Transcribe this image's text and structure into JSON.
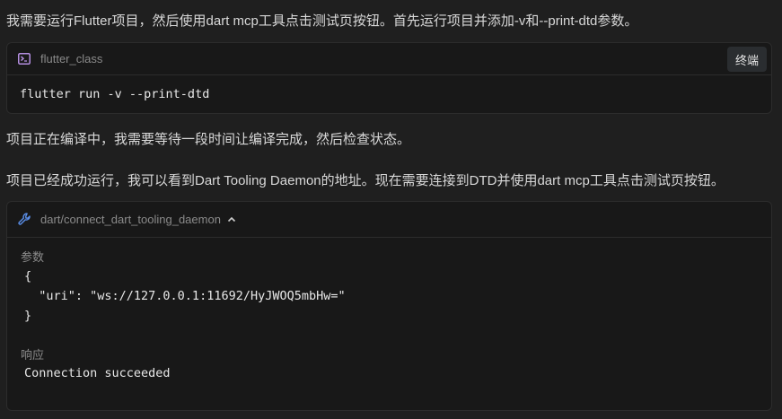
{
  "messages": {
    "intro": "我需要运行Flutter项目，然后使用dart mcp工具点击测试页按钮。首先运行项目并添加-v和--print-dtd参数。",
    "waiting": "项目正在编译中，我需要等待一段时间让编译完成，然后检查状态。",
    "running": "项目已经成功运行，我可以看到Dart Tooling Daemon的地址。现在需要连接到DTD并使用dart mcp工具点击测试页按钮。"
  },
  "command_card": {
    "icon": "terminal-icon",
    "title": "flutter_class",
    "terminate_label": "终端",
    "command": "flutter run -v --print-dtd"
  },
  "tool_card": {
    "icon": "wrench-icon",
    "title": "dart/connect_dart_tooling_daemon",
    "params_label": "参数",
    "params_open": "{",
    "params_line": "  \"uri\": \"ws://127.0.0.1:11692/HyJWOQ5mbHw=\"",
    "params_close": "}",
    "response_label": "响应",
    "response": "Connection succeeded"
  },
  "colors": {
    "background": "#1f1f1f",
    "card": "#181818",
    "terminal_icon": "#b48ee0",
    "wrench_icon": "#5a8ee8"
  }
}
